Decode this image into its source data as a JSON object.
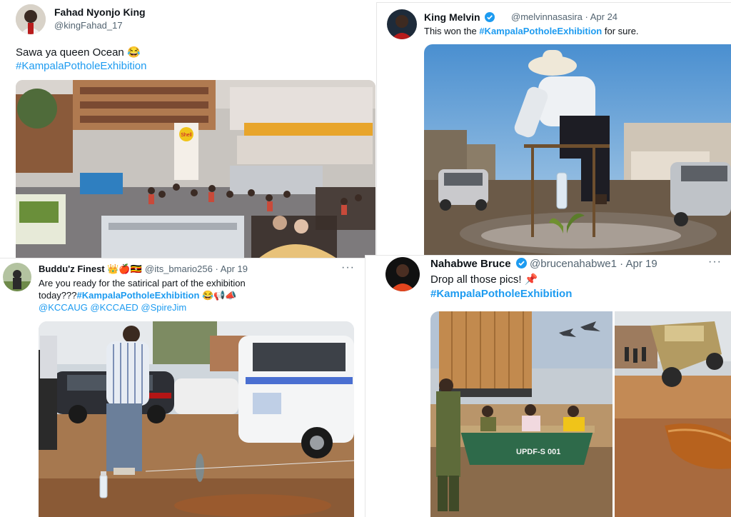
{
  "tweet1": {
    "name": "Fahad Nyonjo King",
    "handle": "@kingFahad_17",
    "text": "Sawa ya queen  Ocean 😂",
    "hashtag": "#KampalaPotholeExhibition"
  },
  "tweet2": {
    "name": "King Melvin",
    "handle": "@melvinnasasira · Apr 24",
    "text_prefix": "This won the ",
    "hashtag": "#KampalaPotholeExhibition",
    "text_suffix": " for sure."
  },
  "tweet3": {
    "name": "Buddu'z Finest 👑🍎🇺🇬",
    "handle": "@its_bmario256 · Apr 19",
    "text_line1": "Are you ready for the satirical part of the exhibition",
    "text_line2_prefix": "today???",
    "hashtag": "#KampalaPotholeExhibition",
    "text_line2_suffix": " 😂📢📣",
    "mentions": "@KCCAUG @KCCAED @SpireJim",
    "more": "···"
  },
  "tweet4": {
    "name": "Nahabwe Bruce",
    "handle": "@brucenahabwe1 · Apr 19",
    "text": "Drop all those pics! 📌",
    "hashtag": "#KampalaPotholeExhibition",
    "more": "···"
  },
  "image_texts": {
    "shell": "Shell",
    "boat_reg": "UPDF-S 001"
  },
  "colors": {
    "link": "#1d9bf0",
    "secondary": "#536471",
    "verified": "#1d9bf0"
  }
}
